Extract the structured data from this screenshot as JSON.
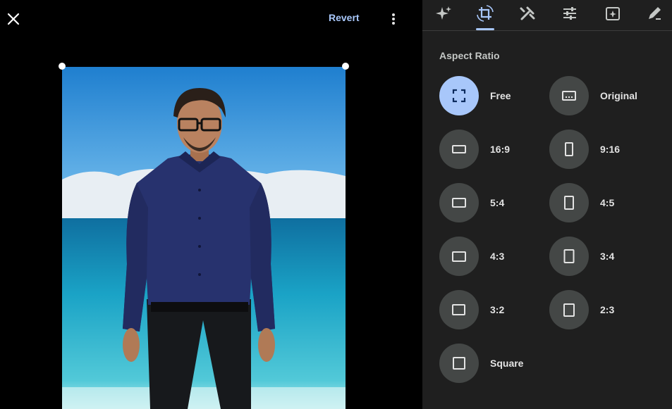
{
  "editor": {
    "close_icon": "close-icon",
    "revert_label": "Revert",
    "more_icon": "more-vert-icon"
  },
  "tool_tabs": [
    {
      "name": "ai-enhance",
      "icon": "sparkle-icon",
      "active": false
    },
    {
      "name": "crop",
      "icon": "crop-rotate-icon",
      "active": true
    },
    {
      "name": "tools",
      "icon": "tools-icon",
      "active": false
    },
    {
      "name": "adjust",
      "icon": "sliders-icon",
      "active": false
    },
    {
      "name": "filters",
      "icon": "filter-add-icon",
      "active": false
    },
    {
      "name": "markup",
      "icon": "markup-pen-icon",
      "active": false
    }
  ],
  "panel": {
    "title": "Aspect Ratio",
    "options": [
      {
        "label": "Free",
        "selected": true
      },
      {
        "label": "Original",
        "selected": false
      },
      {
        "label": "16:9",
        "selected": false
      },
      {
        "label": "9:16",
        "selected": false
      },
      {
        "label": "5:4",
        "selected": false
      },
      {
        "label": "4:5",
        "selected": false
      },
      {
        "label": "4:3",
        "selected": false
      },
      {
        "label": "3:4",
        "selected": false
      },
      {
        "label": "3:2",
        "selected": false
      },
      {
        "label": "2:3",
        "selected": false
      },
      {
        "label": "Square",
        "selected": false
      }
    ]
  },
  "colors": {
    "accent": "#a8c7fa",
    "panel_bg": "#1f1f1f",
    "option_bg": "#444746"
  }
}
